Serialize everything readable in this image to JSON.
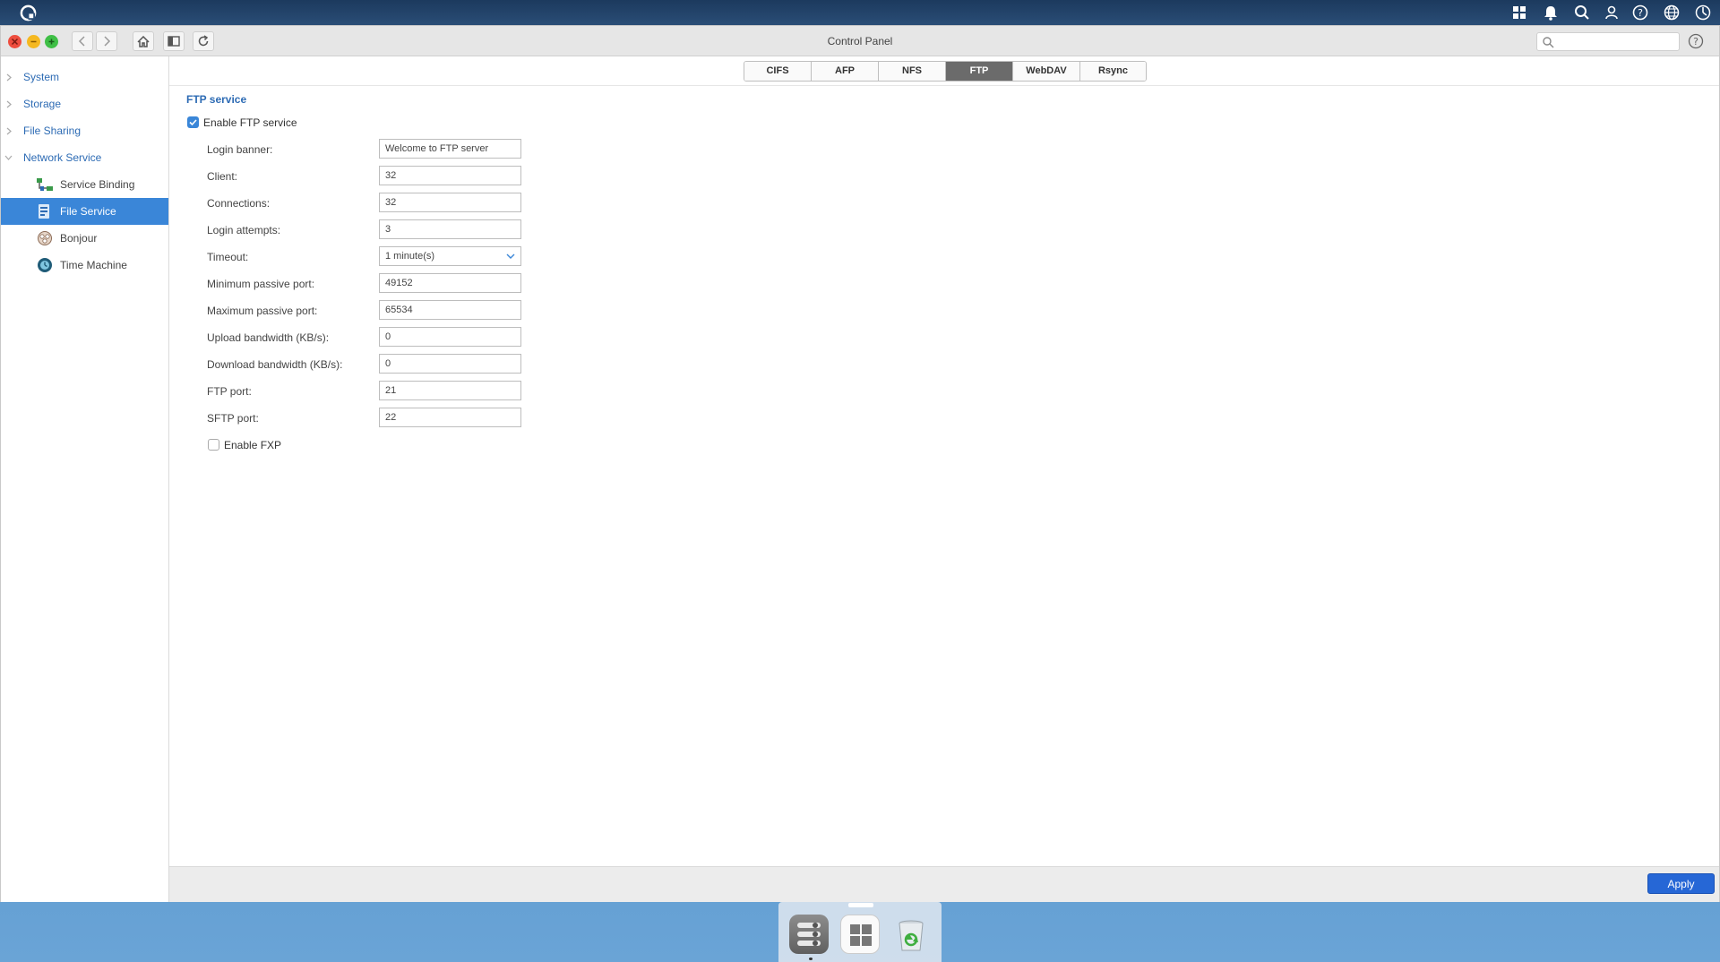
{
  "window": {
    "title": "Control Panel"
  },
  "topbar_icons": [
    "apps-grid-icon",
    "bell-icon",
    "search-icon",
    "user-icon",
    "help-icon",
    "globe-icon",
    "dashboard-icon"
  ],
  "sidebar": {
    "items": [
      {
        "label": "System",
        "type": "category"
      },
      {
        "label": "Storage",
        "type": "category"
      },
      {
        "label": "File Sharing",
        "type": "category"
      },
      {
        "label": "Network Service",
        "type": "category",
        "expanded": true
      },
      {
        "label": "Service Binding",
        "type": "sub",
        "icon": "service-binding-icon"
      },
      {
        "label": "File Service",
        "type": "sub",
        "icon": "file-service-icon",
        "active": true
      },
      {
        "label": "Bonjour",
        "type": "sub",
        "icon": "bonjour-icon"
      },
      {
        "label": "Time Machine",
        "type": "sub",
        "icon": "time-machine-icon"
      }
    ]
  },
  "tabs": [
    {
      "label": "CIFS"
    },
    {
      "label": "AFP"
    },
    {
      "label": "NFS"
    },
    {
      "label": "FTP",
      "active": true
    },
    {
      "label": "WebDAV"
    },
    {
      "label": "Rsync"
    }
  ],
  "ftp": {
    "section_title": "FTP service",
    "enable_label": "Enable FTP service",
    "enable_checked": true,
    "fields": [
      {
        "label": "Login banner:",
        "value": "Welcome to FTP server"
      },
      {
        "label": "Client:",
        "value": "32"
      },
      {
        "label": "Connections:",
        "value": "32"
      },
      {
        "label": "Login attempts:",
        "value": "3"
      },
      {
        "label": "Timeout:",
        "value": "1 minute(s)",
        "type": "select"
      },
      {
        "label": "Minimum passive port:",
        "value": "49152"
      },
      {
        "label": "Maximum passive port:",
        "value": "65534"
      },
      {
        "label": "Upload bandwidth (KB/s):",
        "value": "0"
      },
      {
        "label": "Download bandwidth (KB/s):",
        "value": "0"
      },
      {
        "label": "FTP port:",
        "value": "21"
      },
      {
        "label": "SFTP port:",
        "value": "22"
      }
    ],
    "fxp_label": "Enable FXP",
    "fxp_checked": false
  },
  "footer": {
    "apply_label": "Apply"
  },
  "colors": {
    "accent": "#3a86d8",
    "apply": "#2667d6",
    "link": "#2d6bb4"
  }
}
